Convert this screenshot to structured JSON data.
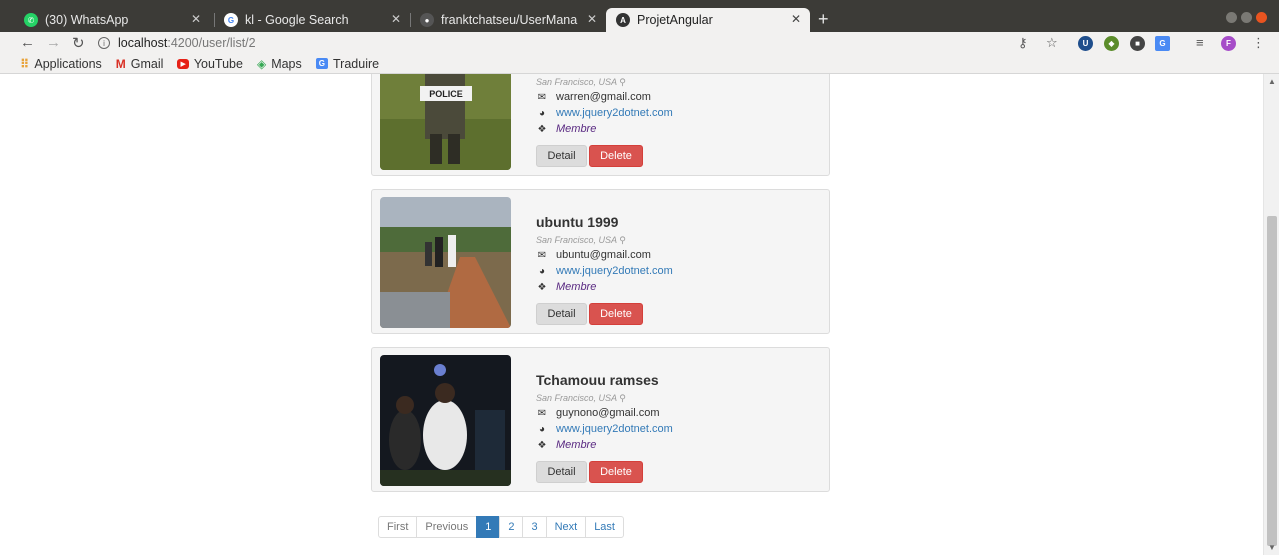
{
  "browser": {
    "tabs": [
      {
        "title": "(30) WhatsApp",
        "favicon": "whatsapp-icon",
        "favicon_color": "#25d366"
      },
      {
        "title": "kl - Google Search",
        "favicon": "google-icon",
        "favicon_color": "#4285f4"
      },
      {
        "title": "franktchatseu/UserMana",
        "favicon": "github-icon",
        "favicon_color": "#555555"
      },
      {
        "title": "ProjetAngular",
        "favicon": "angular-icon",
        "favicon_color": "#333333",
        "active": true
      }
    ],
    "address": {
      "host": "localhost",
      "path": ":4200/user/list/2"
    },
    "bookmarks": [
      {
        "label": "Applications",
        "icon": "apps-grid-icon"
      },
      {
        "label": "Gmail",
        "icon": "gmail-icon"
      },
      {
        "label": "YouTube",
        "icon": "youtube-icon"
      },
      {
        "label": "Maps",
        "icon": "maps-icon"
      },
      {
        "label": "Traduire",
        "icon": "translate-icon"
      }
    ]
  },
  "users": [
    {
      "name": "",
      "location": "San Francisco, USA",
      "email": "warren@gmail.com",
      "website": "www.jquery2dotnet.com",
      "role": "Membre"
    },
    {
      "name": "ubuntu 1999",
      "location": "San Francisco, USA",
      "email": "ubuntu@gmail.com",
      "website": "www.jquery2dotnet.com",
      "role": "Membre"
    },
    {
      "name": "Tchamouu ramses",
      "location": "San Francisco, USA",
      "email": "guynono@gmail.com",
      "website": "www.jquery2dotnet.com",
      "role": "Membre"
    }
  ],
  "buttons": {
    "detail": "Detail",
    "delete": "Delete"
  },
  "photo_text": {
    "police": "POLICE"
  },
  "pagination": {
    "first": "First",
    "previous": "Previous",
    "pages": [
      "1",
      "2",
      "3"
    ],
    "active": "1",
    "next": "Next",
    "last": "Last"
  },
  "colors": {
    "primary": "#337ab7",
    "danger": "#d9534f",
    "role": "#5a2a82"
  }
}
